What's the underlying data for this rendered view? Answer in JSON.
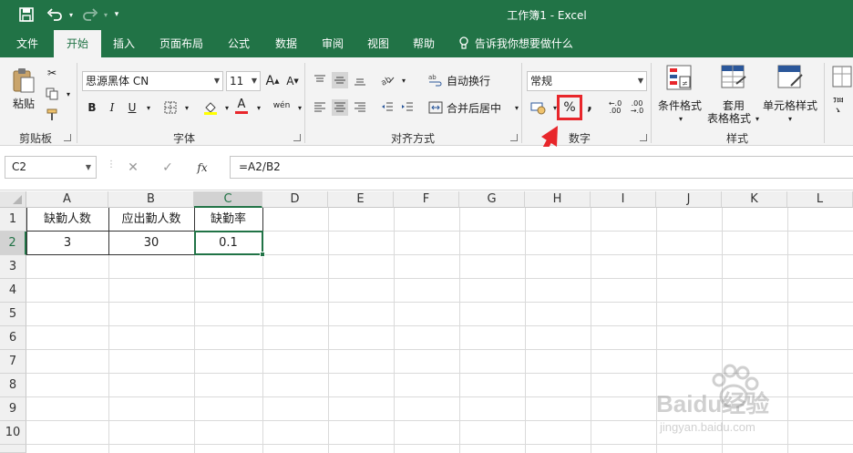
{
  "window": {
    "title": "工作簿1  -  Excel"
  },
  "quick_access": {
    "save_icon": "save-icon",
    "undo_icon": "undo-icon",
    "redo_icon": "redo-icon",
    "customize_icon": "chevron-down-icon"
  },
  "tabs": [
    {
      "label": "文件",
      "active": false
    },
    {
      "label": "开始",
      "active": true
    },
    {
      "label": "插入",
      "active": false
    },
    {
      "label": "页面布局",
      "active": false
    },
    {
      "label": "公式",
      "active": false
    },
    {
      "label": "数据",
      "active": false
    },
    {
      "label": "审阅",
      "active": false
    },
    {
      "label": "视图",
      "active": false
    },
    {
      "label": "帮助",
      "active": false
    }
  ],
  "tell_me": "告诉我你想要做什么",
  "ribbon": {
    "clipboard": {
      "paste_label": "粘贴",
      "group_label": "剪贴板"
    },
    "font": {
      "font_name": "思源黑体 CN",
      "font_size": "11",
      "group_label": "字体",
      "bold": "B",
      "italic": "I",
      "underline": "U",
      "grow": "A",
      "shrink": "A",
      "phonetic": "wén",
      "font_color_letter": "A"
    },
    "alignment": {
      "wrap_text": "自动换行",
      "merge_center": "合并后居中",
      "group_label": "对齐方式"
    },
    "number": {
      "format": "常规",
      "percent": "%",
      "comma": ",",
      "group_label": "数字",
      "inc_decimal": "←.0\n.00",
      "dec_decimal": ".00\n→.0"
    },
    "styles": {
      "conditional": "条件格式",
      "table_format_1": "套用",
      "table_format_2": "表格格式",
      "cell_styles": "单元格样式",
      "group_label": "样式"
    },
    "cells": {
      "insert": "插入"
    }
  },
  "formula_bar": {
    "name_box": "C2",
    "fx": "fx",
    "formula": "=A2/B2"
  },
  "sheet": {
    "columns": [
      "A",
      "B",
      "C",
      "D",
      "E",
      "F",
      "G",
      "H",
      "I",
      "J",
      "K",
      "L"
    ],
    "rows": [
      "1",
      "2",
      "3",
      "4",
      "5",
      "6",
      "7",
      "8",
      "9",
      "10"
    ],
    "header_row": [
      "缺勤人数",
      "应出勤人数",
      "缺勤率"
    ],
    "data_row": [
      "3",
      "30",
      "0.1"
    ],
    "selected_cell": "C2"
  },
  "watermark": {
    "brand": "Baidu经验",
    "url": "jingyan.baidu.com"
  },
  "colors": {
    "excel_green": "#217346",
    "highlight_red": "#e8262b"
  }
}
